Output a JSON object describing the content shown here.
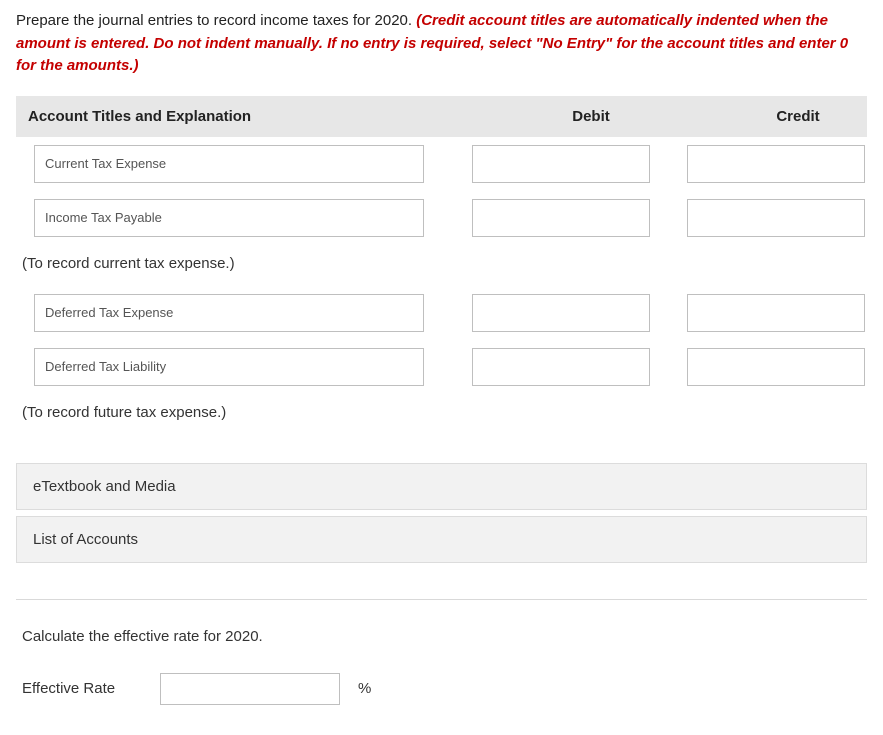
{
  "instruction": {
    "black": "Prepare the journal entries to record income taxes for 2020. ",
    "red": "(Credit account titles are automatically indented when the amount is entered. Do not indent manually. If no entry is required, select \"No Entry\" for the account titles and enter 0 for the amounts.)"
  },
  "headers": {
    "account": "Account Titles and Explanation",
    "debit": "Debit",
    "credit": "Credit"
  },
  "rows": [
    {
      "account": "Current Tax Expense",
      "debit": "",
      "credit": ""
    },
    {
      "account": "Income Tax Payable",
      "debit": "",
      "credit": ""
    }
  ],
  "note1": "(To record current tax expense.)",
  "rows2": [
    {
      "account": "Deferred Tax Expense",
      "debit": "",
      "credit": ""
    },
    {
      "account": "Deferred Tax Liability",
      "debit": "",
      "credit": ""
    }
  ],
  "note2": "(To record future tax expense.)",
  "accordion": {
    "etext": "eTextbook and Media",
    "loa": "List of Accounts"
  },
  "calc": {
    "prompt": "Calculate the effective rate for 2020.",
    "label": "Effective Rate",
    "value": "",
    "unit": "%"
  }
}
